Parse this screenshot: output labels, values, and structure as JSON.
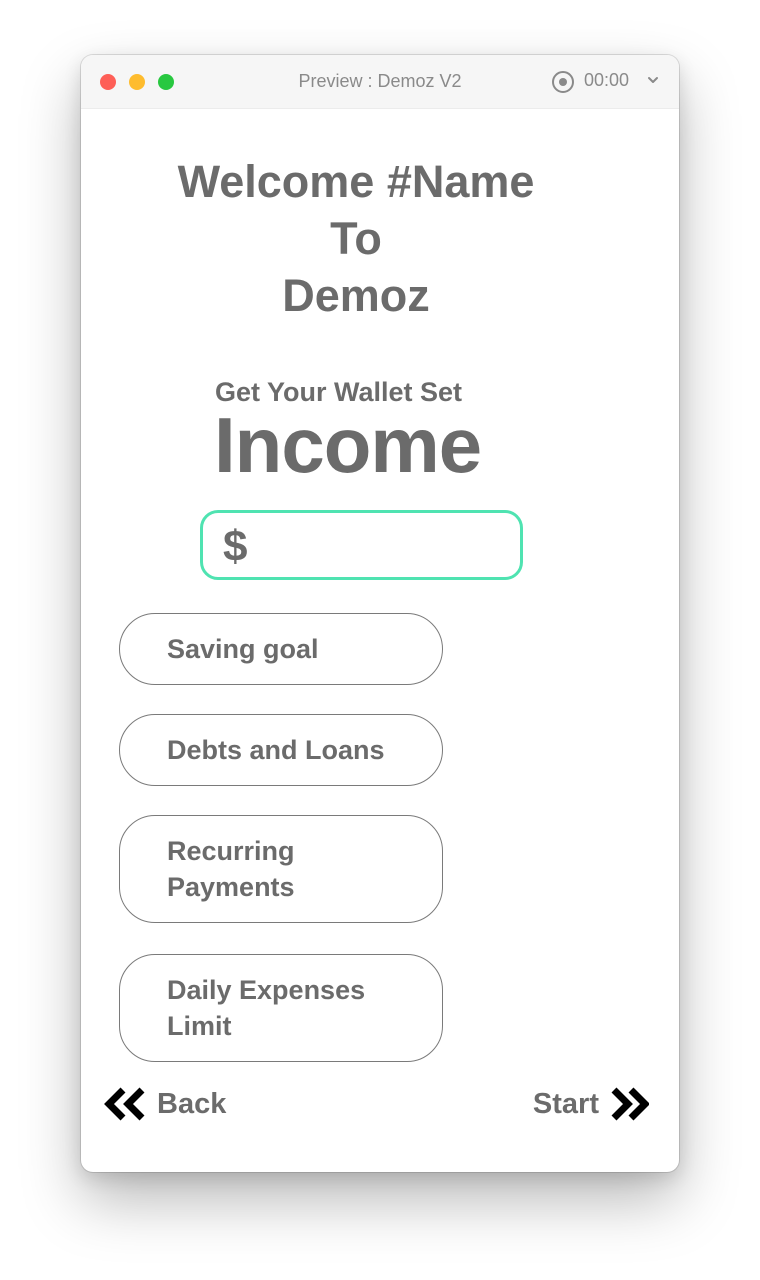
{
  "window": {
    "title": "Preview : Demoz V2",
    "timer": "00:00",
    "icons": [
      "close-light",
      "minimize-light",
      "zoom-light",
      "record-icon",
      "chevron-down-icon"
    ]
  },
  "header": {
    "line1": "Welcome #Name",
    "line2": "To",
    "line3": "Demoz"
  },
  "setup": {
    "subtitle": "Get Your Wallet Set",
    "title": "Income",
    "currency_symbol": "$",
    "income_value": ""
  },
  "options": [
    {
      "line1": "Saving goal",
      "line2": ""
    },
    {
      "line1": "Debts and Loans",
      "line2": ""
    },
    {
      "line1": "Recurring",
      "line2": "Payments"
    },
    {
      "line1": "Daily Expenses",
      "line2": "Limit"
    }
  ],
  "nav": {
    "back_label": "Back",
    "start_label": "Start",
    "back_icon": "double-chevron-left-icon",
    "start_icon": "double-chevron-right-icon"
  },
  "colors": {
    "text": "#6b6b6b",
    "accent_border": "#4fe3b1",
    "traffic_red": "#fe5f57",
    "traffic_yellow": "#febc2e",
    "traffic_green": "#28c840"
  }
}
